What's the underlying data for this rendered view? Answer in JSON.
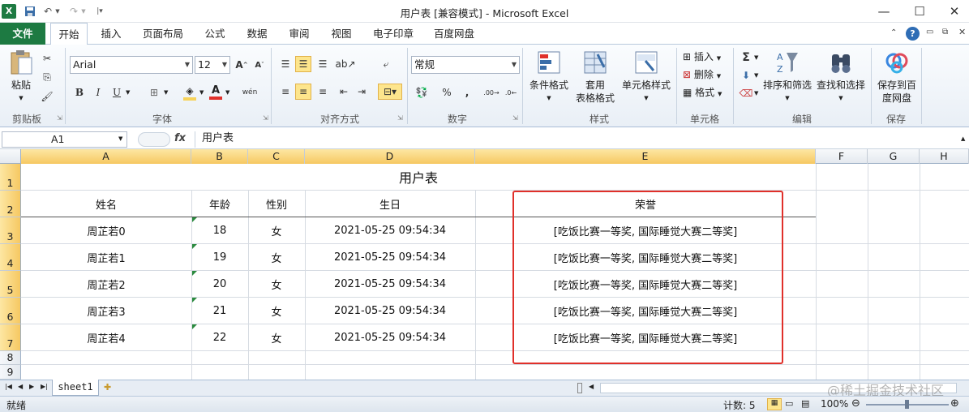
{
  "window": {
    "title": "用户表  [兼容模式]  -  Microsoft Excel",
    "controls": [
      "minimize",
      "maximize",
      "close"
    ]
  },
  "ribbon_tabs": [
    "文件",
    "开始",
    "插入",
    "页面布局",
    "公式",
    "数据",
    "审阅",
    "视图",
    "电子印章",
    "百度网盘"
  ],
  "ribbon": {
    "clipboard": {
      "paste": "粘贴",
      "label": "剪贴板"
    },
    "font": {
      "name": "Arial",
      "size": "12",
      "bold": "B",
      "italic": "I",
      "underline": "U",
      "label": "字体",
      "font_color": "#e0302a",
      "fill_color": "#f7d35a"
    },
    "alignment": {
      "label": "对齐方式"
    },
    "number": {
      "format": "常规",
      "percent": "%",
      "comma": ",",
      "label": "数字"
    },
    "styles": {
      "conditional": "条件格式",
      "table_1": "套用",
      "table_2": "表格格式",
      "cell_styles": "单元格样式",
      "label": "样式"
    },
    "cells": {
      "insert": "插入",
      "delete": "删除",
      "format": "格式",
      "label": "单元格"
    },
    "editing": {
      "sigma": "Σ",
      "sort": "排序和筛选",
      "find": "查找和选择",
      "label": "编辑"
    },
    "save": {
      "btn_1": "保存到百",
      "btn_2": "度网盘",
      "label": "保存"
    }
  },
  "formula_bar": {
    "name_box": "A1",
    "fx": "fx",
    "content": "用户表"
  },
  "columns": [
    "A",
    "B",
    "C",
    "D",
    "E",
    "F",
    "G",
    "H"
  ],
  "rows": [
    "1",
    "2",
    "3",
    "4",
    "5",
    "6",
    "7",
    "8",
    "9"
  ],
  "sheet": {
    "title": "用户表",
    "headers": [
      "姓名",
      "年龄",
      "性别",
      "生日",
      "荣誉"
    ],
    "data": [
      [
        "周芷若0",
        "18",
        "女",
        "2021-05-25 09:54:34",
        "[吃饭比赛一等奖, 国际睡觉大赛二等奖]"
      ],
      [
        "周芷若1",
        "19",
        "女",
        "2021-05-25 09:54:34",
        "[吃饭比赛一等奖, 国际睡觉大赛二等奖]"
      ],
      [
        "周芷若2",
        "20",
        "女",
        "2021-05-25 09:54:34",
        "[吃饭比赛一等奖, 国际睡觉大赛二等奖]"
      ],
      [
        "周芷若3",
        "21",
        "女",
        "2021-05-25 09:54:34",
        "[吃饭比赛一等奖, 国际睡觉大赛二等奖]"
      ],
      [
        "周芷若4",
        "22",
        "女",
        "2021-05-25 09:54:34",
        "[吃饭比赛一等奖, 国际睡觉大赛二等奖]"
      ]
    ]
  },
  "sheet_tabs": [
    "sheet1"
  ],
  "status": {
    "ready": "就绪",
    "count": "计数: 5",
    "zoom": "100%"
  },
  "watermark": "@稀土掘金技术社区",
  "colors": {
    "accent": "#1d7a42",
    "highlight": "#e0302a"
  }
}
